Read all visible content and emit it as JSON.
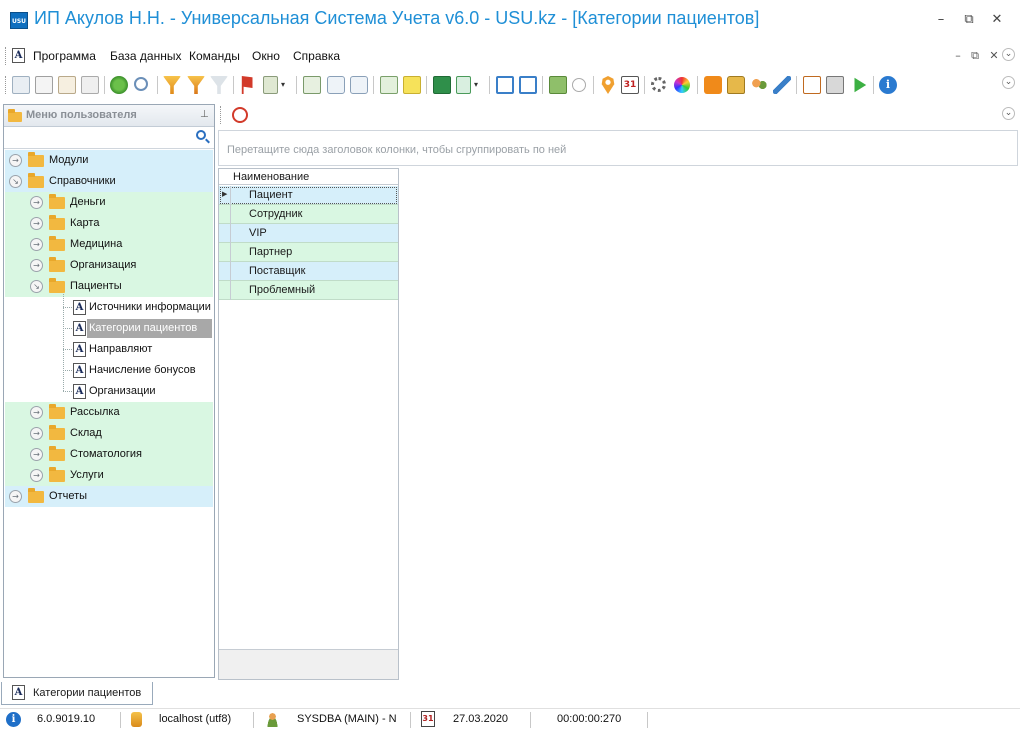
{
  "window": {
    "logo_text": "USU",
    "title": "ИП Акулов Н.Н. - Универсальная Система Учета v6.0 - USU.kz - [Категории пациентов]"
  },
  "menu": {
    "items": [
      "Программа",
      "База данных",
      "Команды",
      "Окно",
      "Справка"
    ]
  },
  "sidebar": {
    "title": "Меню пользователя",
    "tree": [
      {
        "label": "Модули",
        "level": 0,
        "type": "folder",
        "state": "collapsed"
      },
      {
        "label": "Справочники",
        "level": 0,
        "type": "folder",
        "state": "expanded"
      },
      {
        "label": "Деньги",
        "level": 1,
        "type": "folder",
        "state": "collapsed"
      },
      {
        "label": "Карта",
        "level": 1,
        "type": "folder",
        "state": "collapsed"
      },
      {
        "label": "Медицина",
        "level": 1,
        "type": "folder",
        "state": "collapsed"
      },
      {
        "label": "Организация",
        "level": 1,
        "type": "folder",
        "state": "collapsed"
      },
      {
        "label": "Пациенты",
        "level": 1,
        "type": "folder",
        "state": "expanded"
      },
      {
        "label": "Источники информации",
        "level": 2,
        "type": "doc"
      },
      {
        "label": "Категории пациентов",
        "level": 2,
        "type": "doc",
        "selected": true
      },
      {
        "label": "Направляют",
        "level": 2,
        "type": "doc"
      },
      {
        "label": "Начисление бонусов",
        "level": 2,
        "type": "doc"
      },
      {
        "label": "Организации",
        "level": 2,
        "type": "doc"
      },
      {
        "label": "Рассылка",
        "level": 1,
        "type": "folder",
        "state": "collapsed"
      },
      {
        "label": "Склад",
        "level": 1,
        "type": "folder",
        "state": "collapsed"
      },
      {
        "label": "Стоматология",
        "level": 1,
        "type": "folder",
        "state": "collapsed"
      },
      {
        "label": "Услуги",
        "level": 1,
        "type": "folder",
        "state": "collapsed"
      },
      {
        "label": "Отчеты",
        "level": 0,
        "type": "folder",
        "state": "collapsed"
      }
    ]
  },
  "main": {
    "group_hint": "Перетащите сюда заголовок колонки, чтобы сгруппировать по ней",
    "grid": {
      "column": "Наименование",
      "rows": [
        "Пациент",
        "Сотрудник",
        "VIP",
        "Партнер",
        "Поставщик",
        "Проблемный"
      ]
    }
  },
  "bottom_tab": {
    "label": "Категории пациентов",
    "icon_letter": "A"
  },
  "status": {
    "version": "6.0.9019.10",
    "server": "localhost (utf8)",
    "user": "SYSDBA (MAIN) - N",
    "calendar_day": "31",
    "date": "27.03.2020",
    "timer": "00:00:00:270"
  },
  "colors": {
    "title": "#1f8fd6",
    "row_blue": "#d6effa",
    "row_green": "#d9f7e2",
    "selected": "#a8a8a8"
  }
}
